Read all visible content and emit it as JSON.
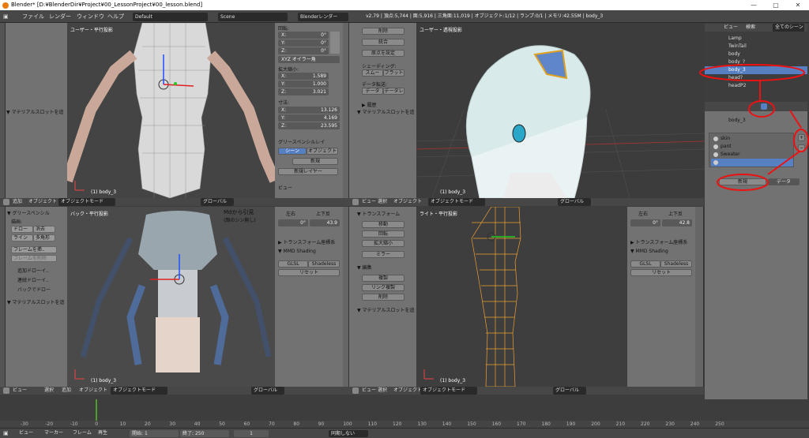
{
  "window": {
    "title": "Blender* [D:¥BlenderDir¥Project¥00_LessonProject¥00_lesson.blend]",
    "min": "—",
    "max": "▢",
    "close": "✕"
  },
  "info": {
    "menus": [
      "ファイル",
      "レンダー",
      "ウィンドウ",
      "ヘルプ"
    ],
    "layout": "Default",
    "scene": "Scene",
    "engine": "Blenderレンダー",
    "stats": "v2.79 | 頂点:5,744 | 面:5,916 | 三角面:11,019 | オブジェクト:1/12 | ランプ:0/1 | メモリ:42.55M | body_3"
  },
  "views": {
    "tl": "ユーザー・平行投影",
    "tr": "ユーザー・透視投影",
    "bl": "バック・平行投影",
    "br": "ライト・平行投影",
    "obj": "(1) body_3"
  },
  "tl_panel": {
    "rot": "回転:",
    "rx": "X:",
    "ry": "Y:",
    "rz": "Z:",
    "rxv": "0°",
    "ryv": "0°",
    "rzv": "0°",
    "euler": "XYZ オイラー角",
    "scale": "拡大縮小:",
    "sx": "X:",
    "sy": "Y:",
    "sz": "Z:",
    "sxv": "1.589",
    "syv": "1.000",
    "szv": "3.021",
    "dim": "寸法:",
    "dx": "X:",
    "dy": "Y:",
    "dz": "Z:",
    "dxv": "13.126",
    "dyv": "4.169",
    "dzv": "23.595",
    "gp": "グリースペンシルレイ",
    "scene": "シーン",
    "object": "オブジェクト",
    "new": "新規",
    "newlayer": "新規レイヤー",
    "view": "ビュー"
  },
  "tl_tool": {
    "matslot": "▼ マテリアルスロットを追"
  },
  "tr_tool": {
    "items": [
      "削除",
      "統合",
      "原点を設定"
    ],
    "shading": "シェーディング:",
    "smooth": "スムー",
    "flat": "フラット",
    "datatransfer": "データ転送:",
    "d1": "データ",
    "d2": "データレ",
    "history": "▶ 履歴",
    "matslot": "▼ マテリアルスロットを追"
  },
  "bl_tool": {
    "gp": "▼ グリースペンシル",
    "draw": "描画:",
    "d1": "ドロー",
    "d2": "消去",
    "d3": "ライン",
    "d4": "多角形",
    "frame": "フレームを挿..",
    "framedel": "フレームを削除",
    "c1": "追加ドローイ..",
    "c2": "連続ドローイ..",
    "c3": "バックでドロー",
    "matslot": "▼ マテリアルスロットを追",
    "note1": "Mdから引見",
    "note2": "(顔のシン無し)"
  },
  "bl_panel": {
    "lr": "左右",
    "ud": "上下反",
    "a": "0°",
    "b": "43.9",
    "transform": "▶ トランスフォーム座標系",
    "mmd": "▼ MMD Shading",
    "glsl": "GLSL",
    "shadeless": "Shadeless",
    "reset": "リセット"
  },
  "br_tool": {
    "transform": "▼ トランスフォーム",
    "items": [
      "移動",
      "回転",
      "拡大縮小",
      "ミラー"
    ],
    "edit": "▼ 編集",
    "items2": [
      "複製",
      "リンク複製",
      "削除"
    ],
    "matslot": "▼ マテリアルスロットを追"
  },
  "br_panel": {
    "lr": "左右",
    "ud": "上下反",
    "a": "0°",
    "b": "42.8",
    "transform": "▶ トランスフォーム座標系",
    "mmd": "▼ MMD Shading",
    "glsl": "GLSL",
    "shadeless": "Shadeless",
    "reset": "リセット"
  },
  "vp_header": {
    "view": "ビュー",
    "select": "選択",
    "add": "追加",
    "object": "オブジェクト",
    "mode": "オブジェクトモード",
    "global": "グローバル"
  },
  "outliner": {
    "view": "ビュー",
    "search": "検索",
    "all": "全てのシーン",
    "rows": [
      "Lamp",
      "TwinTail",
      "body",
      "body_?",
      "body_3",
      "head?",
      "headP2"
    ]
  },
  "props": {
    "object": "body_3",
    "mats": [
      "skin",
      "pant",
      "Sweater",
      ""
    ],
    "new": "新規",
    "data": "データ"
  },
  "timeline": {
    "ticks": [
      "-30",
      "-20",
      "-10",
      "0",
      "10",
      "20",
      "30",
      "40",
      "50",
      "60",
      "70",
      "80",
      "90",
      "100",
      "110",
      "120",
      "130",
      "140",
      "150",
      "160",
      "170",
      "180",
      "190",
      "200",
      "210",
      "220",
      "230",
      "240",
      "250"
    ],
    "view": "ビュー",
    "marker": "マーカー",
    "frame": "フレーム",
    "play": "再生",
    "start": "開始:",
    "startv": "1",
    "end": "終了:",
    "endv": "250",
    "cur": "1",
    "sync": "同期しない"
  },
  "colors": {
    "accent": "#5680c2",
    "highlight": "#e11111",
    "wire": "#f0a030"
  }
}
